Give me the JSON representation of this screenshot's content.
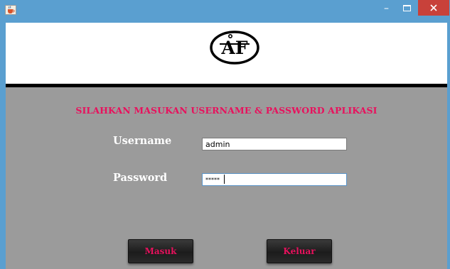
{
  "titlebar": {
    "title": "",
    "icons": {
      "app": "java-cup-icon",
      "minimize": "minimize-icon",
      "maximize": "maximize-icon",
      "close": "close-icon"
    },
    "minimize_glyph": "–"
  },
  "header": {
    "logo_icon": "af-monogram-logo",
    "logo_text": "AF"
  },
  "login": {
    "heading": "SILAHKAN MASUKAN USERNAME & PASSWORD APLIKASI",
    "username_label": "Username",
    "username_value": "admin",
    "password_label": "Password",
    "password_value": "*****",
    "masuk_label": "Masuk",
    "keluar_label": "Keluar"
  },
  "colors": {
    "title_bar": "#5a9fd0",
    "close_button": "#c8413a",
    "panel": "#9b9b9b",
    "accent_text": "#e8115d",
    "button_face": "#1c1c1c"
  }
}
